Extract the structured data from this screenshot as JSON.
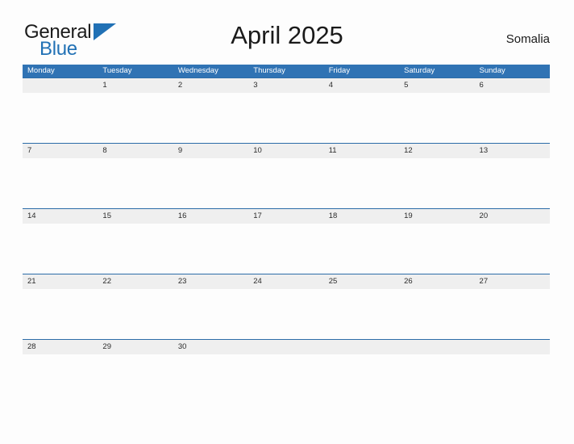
{
  "brand": {
    "name_part1": "General",
    "name_part2": "Blue",
    "accent_color": "#2171b5"
  },
  "header": {
    "title": "April 2025",
    "region": "Somalia"
  },
  "calendar": {
    "header_color": "#3073b4",
    "date_band_color": "#efefef",
    "weekdays": [
      "Monday",
      "Tuesday",
      "Wednesday",
      "Thursday",
      "Friday",
      "Saturday",
      "Sunday"
    ],
    "weeks": [
      [
        "",
        "1",
        "2",
        "3",
        "4",
        "5",
        "6"
      ],
      [
        "7",
        "8",
        "9",
        "10",
        "11",
        "12",
        "13"
      ],
      [
        "14",
        "15",
        "16",
        "17",
        "18",
        "19",
        "20"
      ],
      [
        "21",
        "22",
        "23",
        "24",
        "25",
        "26",
        "27"
      ],
      [
        "28",
        "29",
        "30",
        "",
        "",
        "",
        ""
      ]
    ]
  }
}
